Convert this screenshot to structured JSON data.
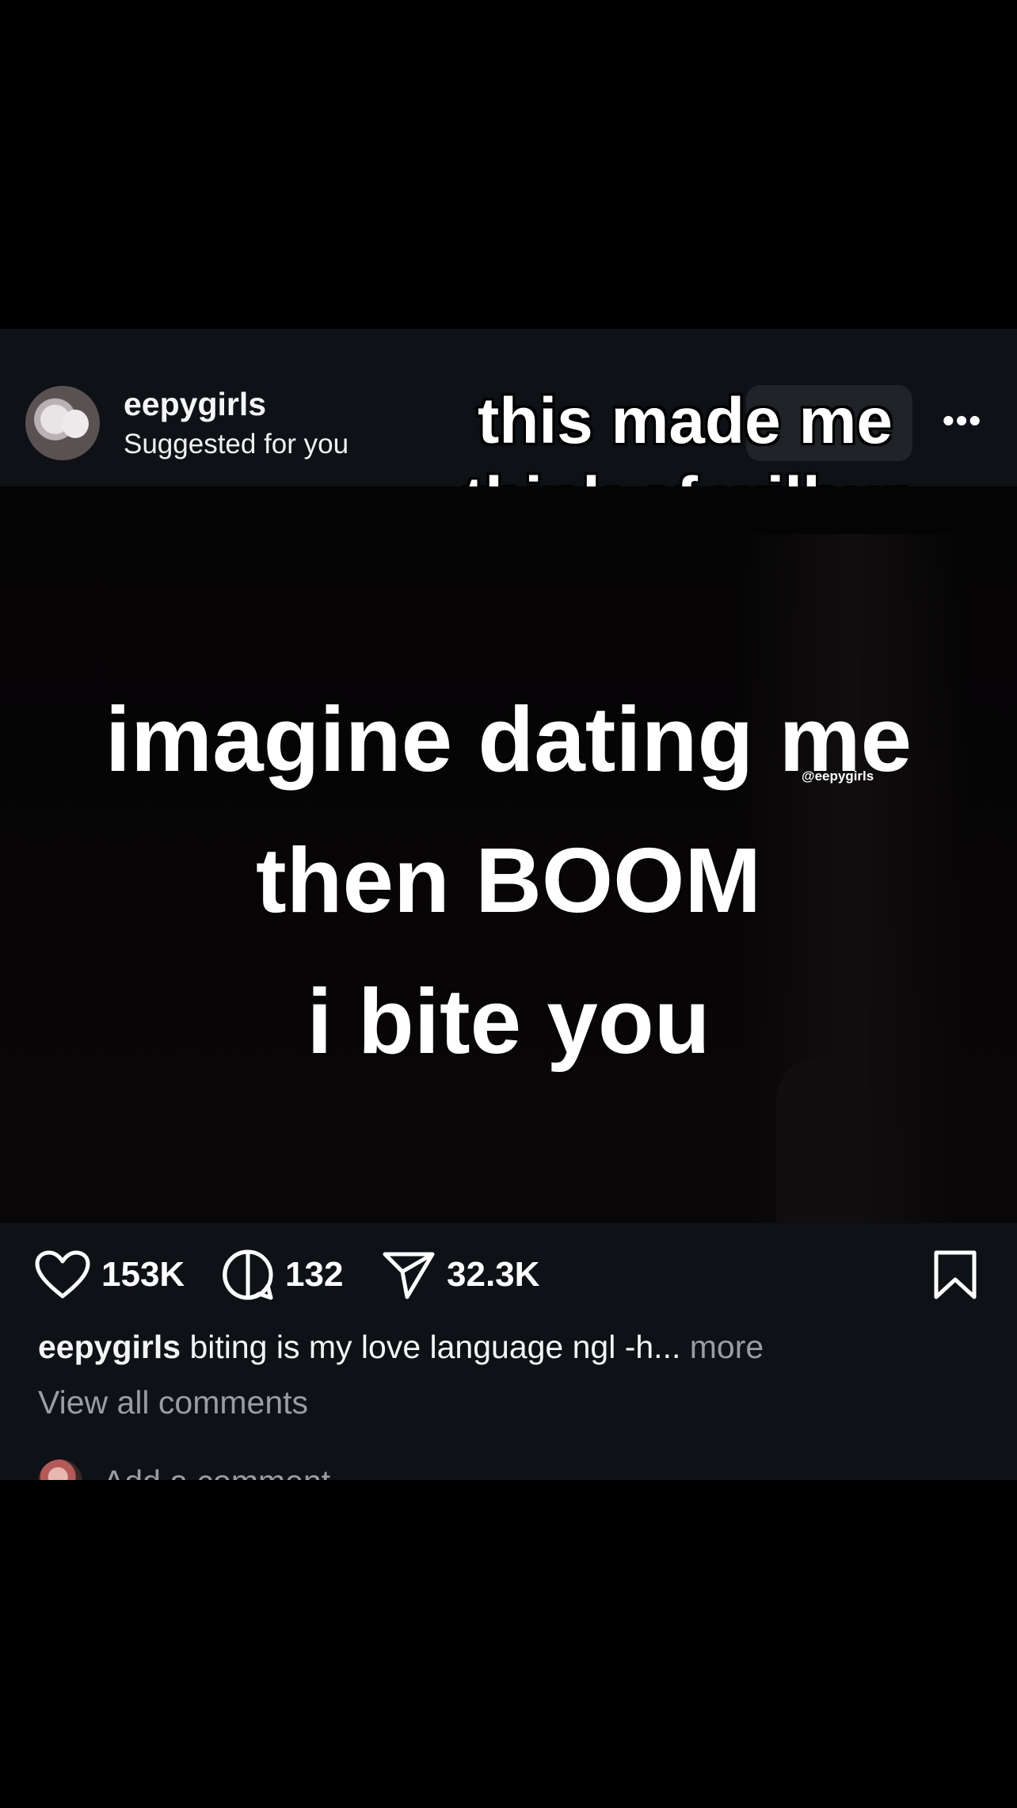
{
  "post": {
    "header": {
      "username": "eepygirls",
      "subtitle": "Suggested for you",
      "more_label": "•••"
    },
    "overlay_caption": "this made me\nthink of wilbur",
    "media": {
      "text": "imagine dating me\nthen BOOM\ni bite you",
      "watermark": "@eepygirls"
    },
    "actions": {
      "likes": "153K",
      "comments": "132",
      "shares": "32.3K"
    },
    "caption": {
      "username": "eepygirls",
      "text": "biting is my love language ngl -h...",
      "more": "more"
    },
    "view_comments": "View all comments",
    "add_comment_placeholder": "Add a comment..."
  },
  "icons": [
    "avatar",
    "more-icon",
    "heart-icon",
    "comment-icon",
    "share-icon",
    "bookmark-icon"
  ],
  "colors": {
    "background": "#000000",
    "post_background": "#0e1116",
    "text_primary": "#f5f5f5",
    "text_secondary": "#9a9ca3"
  }
}
